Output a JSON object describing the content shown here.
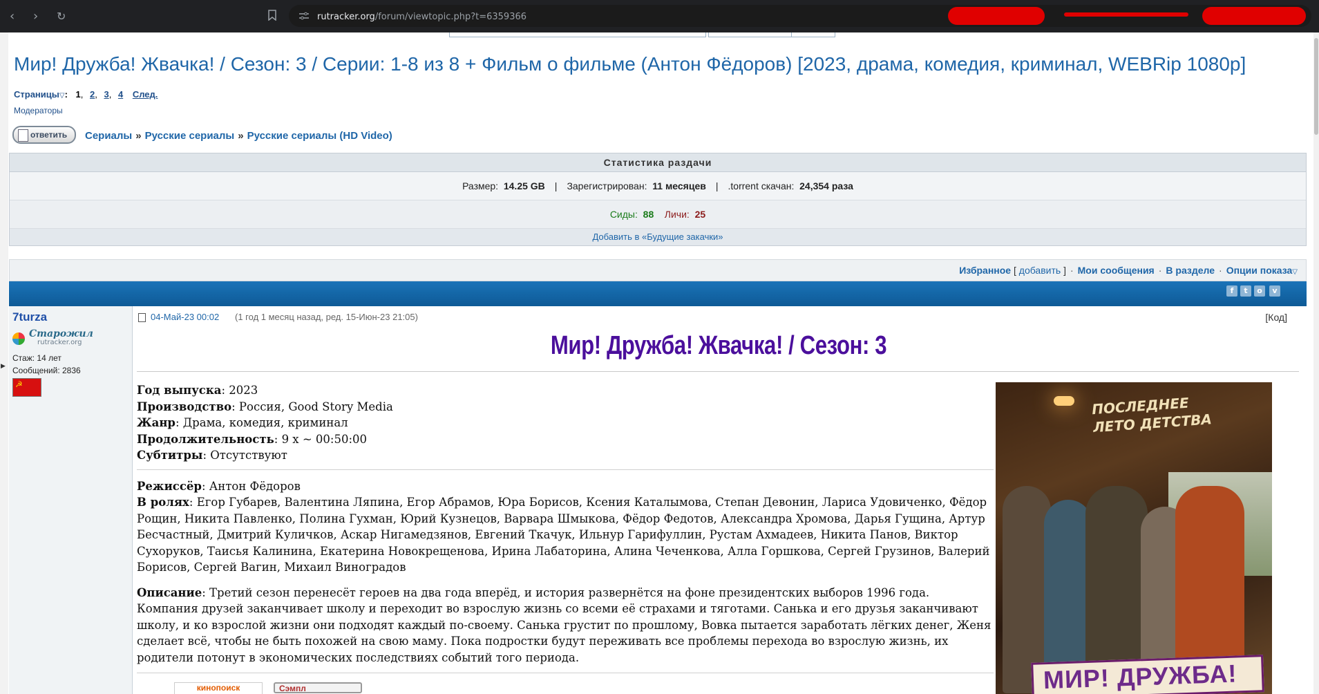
{
  "browser": {
    "back_icon": "arrow-left-icon",
    "forward_icon": "arrow-right-icon",
    "reload_icon": "reload-icon",
    "bookmark_icon": "bookmark-icon",
    "url_domain": "rutracker.org",
    "url_path": "/forum/viewtopic.php?t=6359366"
  },
  "topic": {
    "title": "Мир! Дружба! Жвачка! / Сезон: 3 / Серии: 1-8 из 8 + Фильм о фильме (Антон Фёдоров) [2023, драма, комедия, криминал, WEBRip 1080p]",
    "pages_label": "Страницы",
    "pages_current": "1",
    "pages": [
      "2",
      "3",
      "4"
    ],
    "pages_next": "След.",
    "moderators": "Модераторы",
    "reply_button": "ответить",
    "breadcrumbs": [
      "Сериалы",
      "Русские сериалы",
      "Русские сериалы (HD Video)"
    ],
    "breadcrumb_sep": "»"
  },
  "stats": {
    "header": "Статистика раздачи",
    "size_label": "Размер:",
    "size_value": "14.25 GB",
    "registered_label": "Зарегистрирован:",
    "registered_value": "11 месяцев",
    "downloaded_label": ".torrent скачан:",
    "downloaded_value": "24,354 раза",
    "seeders_label": "Сиды:",
    "seeders_value": "88",
    "leechers_label": "Личи:",
    "leechers_value": "25",
    "add_future": "Добавить в «Будущие закачки»",
    "sep": "|"
  },
  "favbar": {
    "favorites": "Избранное",
    "add": "добавить",
    "my_messages": "Мои сообщения",
    "in_section": "В разделе",
    "display_options": "Опции показа"
  },
  "post": {
    "author": "7turza",
    "rank": "Старожил",
    "rank_site": "rutracker.org",
    "stazh": "Стаж: 14 лет",
    "messages": "Сообщений: 2836",
    "flag_glyph": "☭",
    "date": "04-Май-23 00:02",
    "date_meta": "(1 год 1 месяц назад, ред. 15-Июн-23 21:05)",
    "code_link": "[Код]",
    "heading": "Мир! Дружба! Жвачка! / Сезон: 3",
    "year_label": "Год выпуска",
    "year": ": 2023",
    "production_label": "Производство",
    "production": ": Россия, Good Story Media",
    "genre_label": "Жанр",
    "genre": ": Драма, комедия, криминал",
    "duration_label": "Продолжительность",
    "duration": ": 9 x ~ 00:50:00",
    "subs_label": "Субтитры",
    "subs": ": Отсутствуют",
    "director_label": "Режиссёр",
    "director": ": Антон Фёдоров",
    "cast_label": "В ролях",
    "cast": ": Егор Губарев, Валентина Ляпина, Егор Абрамов, Юра Борисов, Ксения Каталымова, Степан Девонин, Лариса Удовиченко, Фёдор Рощин, Никита Павленко, Полина Гухман, Юрий Кузнецов, Варвара Шмыкова, Фёдор Федотов, Александра Хромова, Дарья Гущина, Артур Бесчастный, Дмитрий Куличков, Аскар Нигамедзянов, Евгений Ткачук, Ильнур Гарифуллин, Рустам Ахмадеев, Никита Панов, Виктор Сухоруков, Таисья Калинина, Екатерина Новокрещенова, Ирина Лабаторина, Алина Чеченкова, Алла Горшкова, Сергей Грузинов, Валерий Борисов, Сергей Вагин, Михаил Виноградов",
    "desc_label": "Описание",
    "desc": ": Третий сезон перенесёт героев на два года вперёд, и история развернётся на фоне президентских выборов 1996 года. Компания друзей заканчивает школу и переходит во взрослую жизнь со всеми её страхами и тяготами. Санька и его друзья заканчивают школу, и ко взрослой жизни они подходят каждый по-своему. Санька грустит по прошлому, Вовка пытается заработать лёгких денег, Женя сделает всё, чтобы не быть похожей на свою маму. Пока подростки будут переживать все проблемы перехода во взрослую жизнь, их родители потонут в экономических последствиях событий того периода.",
    "poster_tagline": "ПОСЛЕДНЕЕ ЛЕТО ДЕТСТВА",
    "poster_logo": "МИР! ДРУЖБА!",
    "kinopoisk": "кинопоиск",
    "sample": "Сэмпл"
  },
  "social_icons": [
    "f",
    "t",
    "o",
    "v"
  ],
  "colors": {
    "title_blue": "#1f66a8",
    "heading_purple": "#4b0f9c",
    "seeders_green": "#1a7b1a",
    "leechers_red": "#8b1b1b",
    "header_bar": "#1a73b8"
  }
}
